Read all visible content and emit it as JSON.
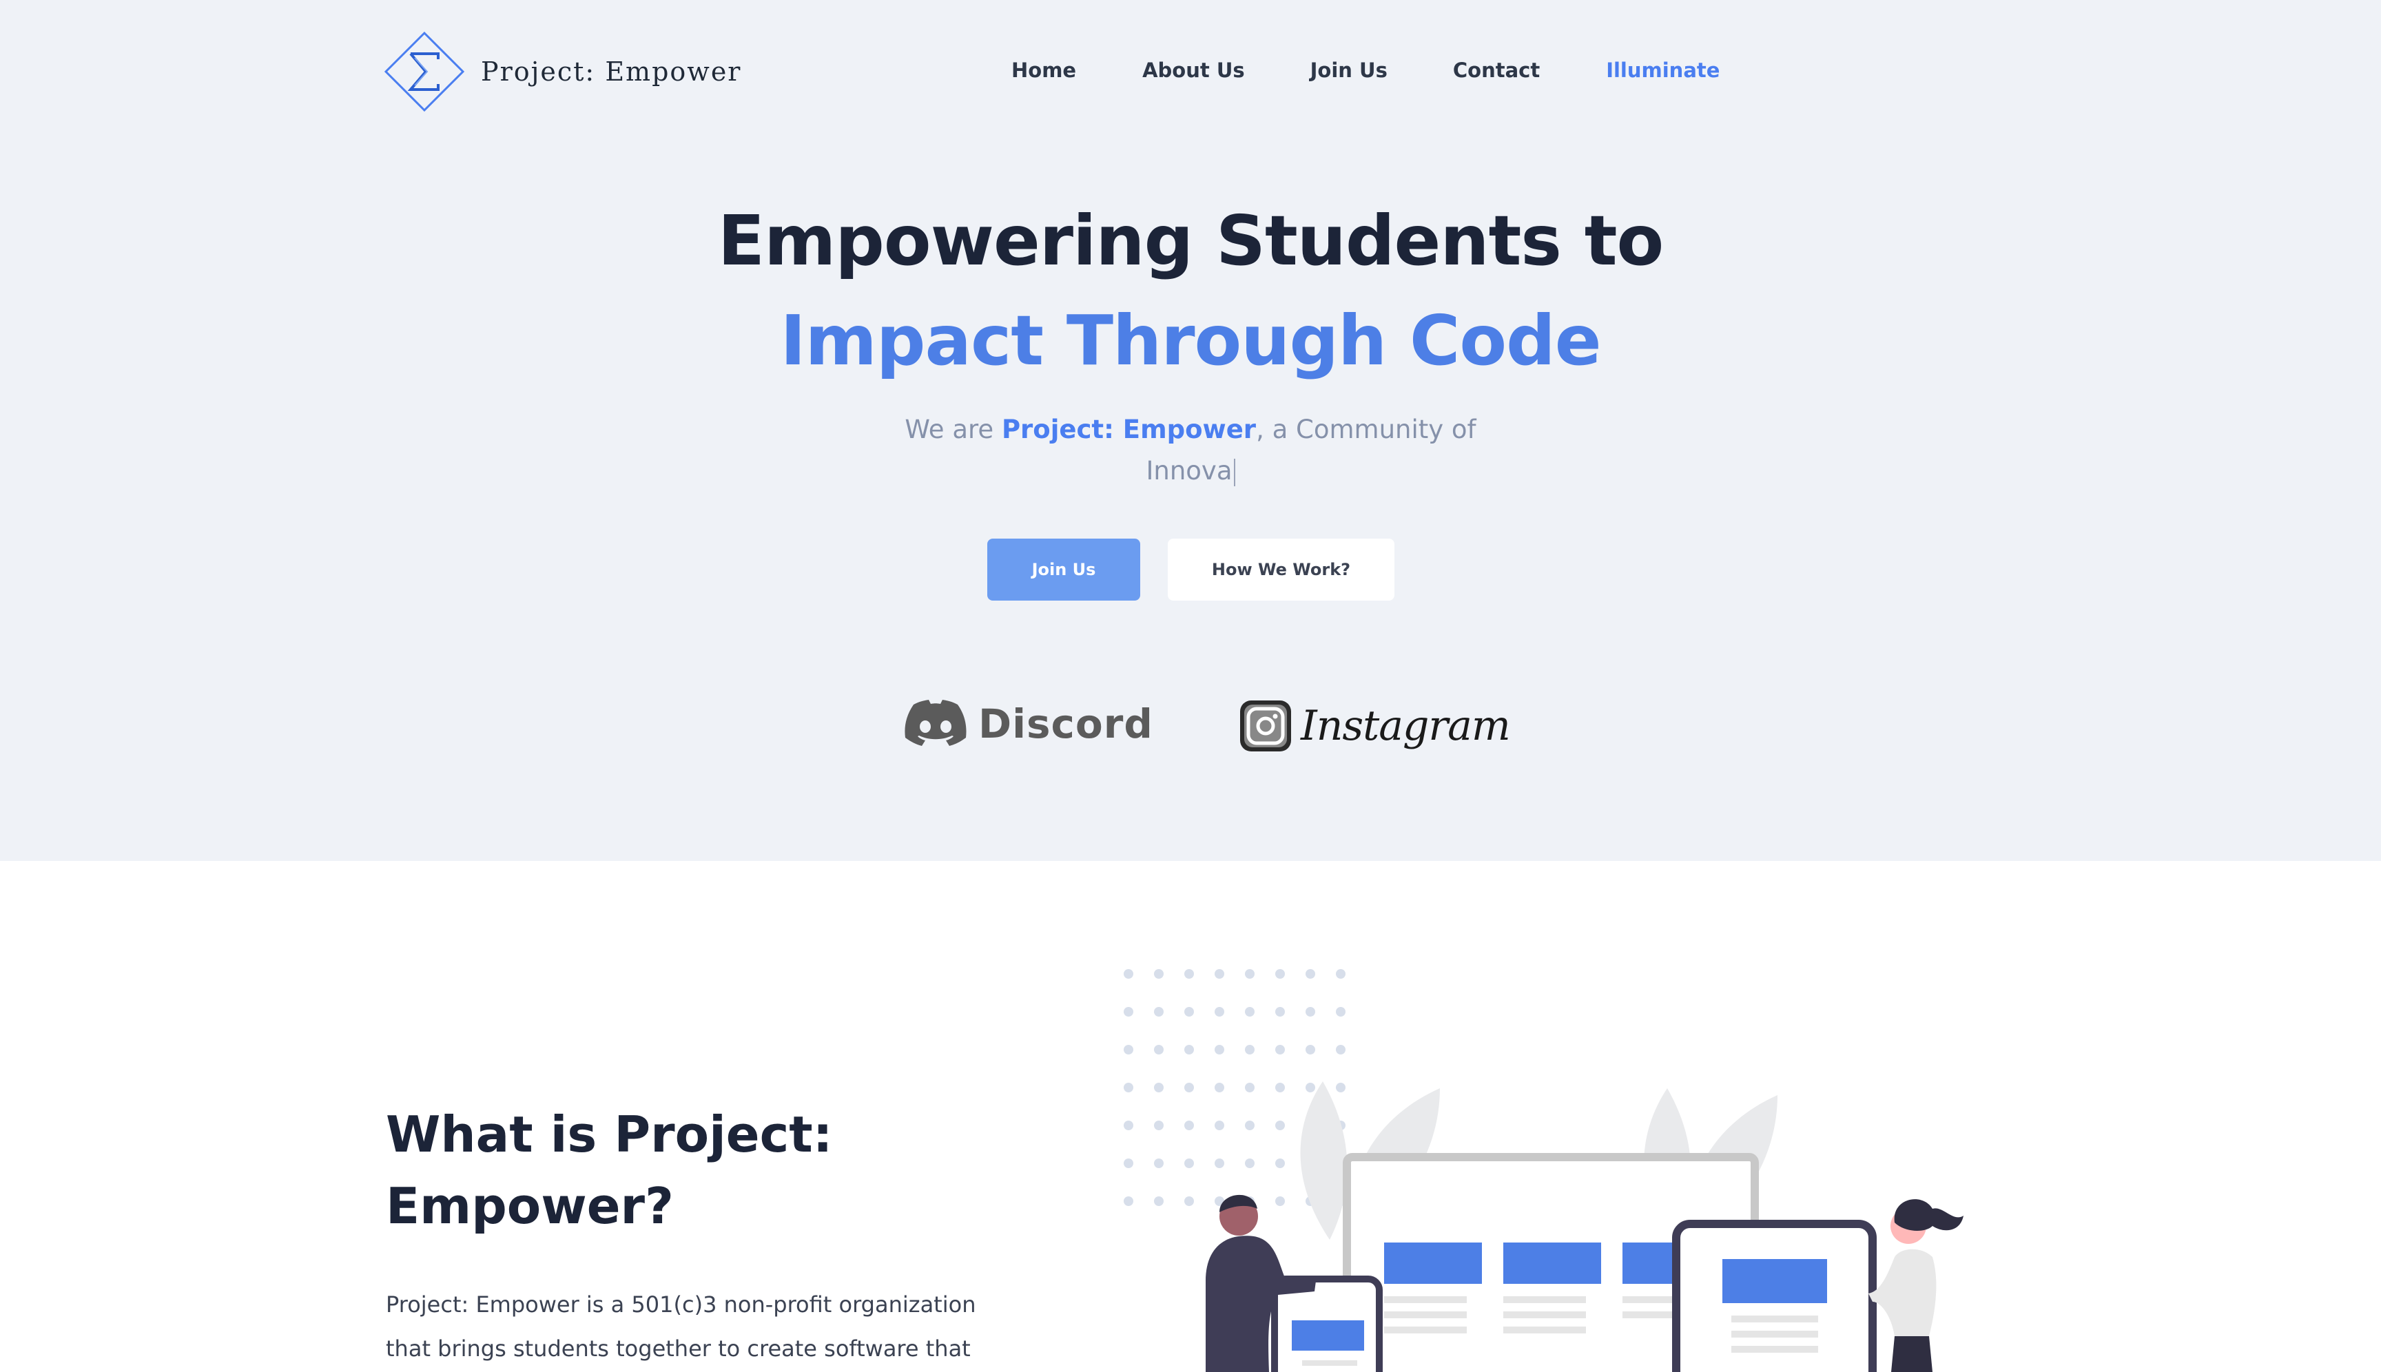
{
  "brand": {
    "name": "Project: Empower",
    "accent": "#4a7ef0",
    "dark": "#1c2438",
    "hero_bg": "#eff2f7"
  },
  "nav": {
    "items": [
      {
        "label": "Home"
      },
      {
        "label": "About Us"
      },
      {
        "label": "Join Us"
      },
      {
        "label": "Contact"
      },
      {
        "label": "Illuminate"
      }
    ]
  },
  "hero": {
    "title_line1": "Empowering Students to",
    "title_line2": "Impact Through Code",
    "subtitle_prefix": "We are ",
    "subtitle_highlight": "Project: Empower",
    "subtitle_suffix": ", a Community of",
    "subtitle_typed": "Innova",
    "join_button": "Join Us",
    "how_button": "How We Work?"
  },
  "social": {
    "discord_label": "Discord",
    "discord_icon": "discord-icon",
    "instagram_label": "Instagram",
    "instagram_icon": "instagram-icon"
  },
  "about": {
    "title_line1": "What is Project:",
    "title_line2": "Empower?",
    "text_line1": "Project: Empower is a 501(c)3 non-profit organization",
    "text_line2": "that brings students together to create software that"
  }
}
